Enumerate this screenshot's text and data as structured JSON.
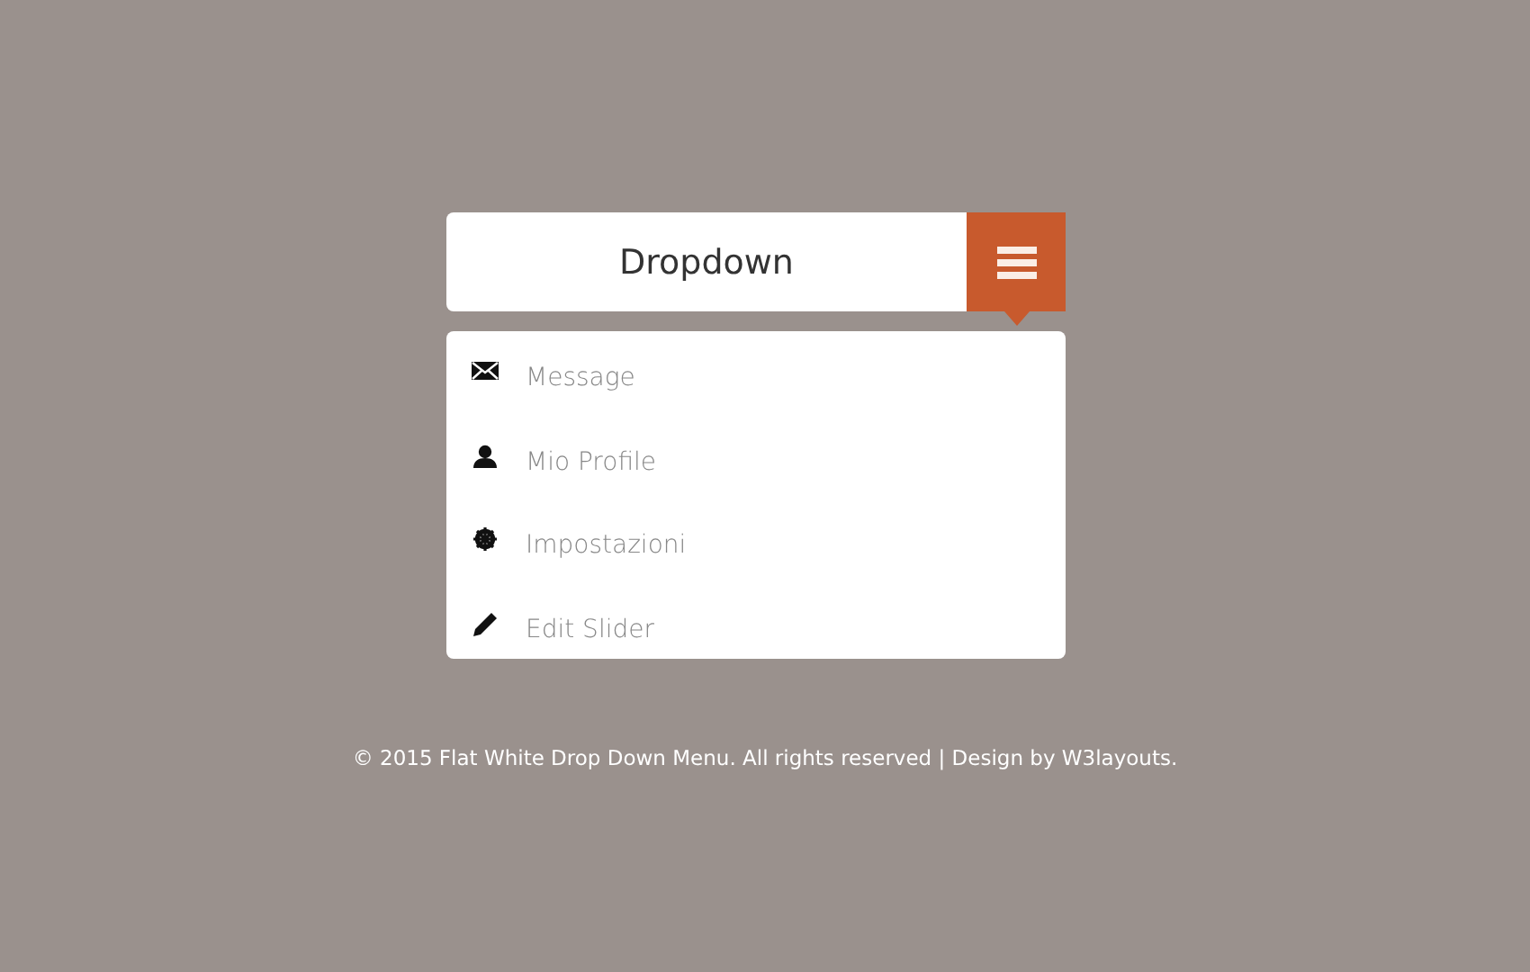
{
  "dropdown": {
    "title": "Dropdown",
    "expanded": true
  },
  "menu": [
    {
      "label": "Message",
      "kind": "envelope"
    },
    {
      "label": "Mio Profile",
      "kind": "user"
    },
    {
      "label": "Impostazioni",
      "kind": "gear"
    },
    {
      "label": "Edit Slider",
      "kind": "pencil"
    }
  ],
  "footer": "© 2015 Flat White Drop Down Menu. All rights reserved | Design by W3layouts."
}
